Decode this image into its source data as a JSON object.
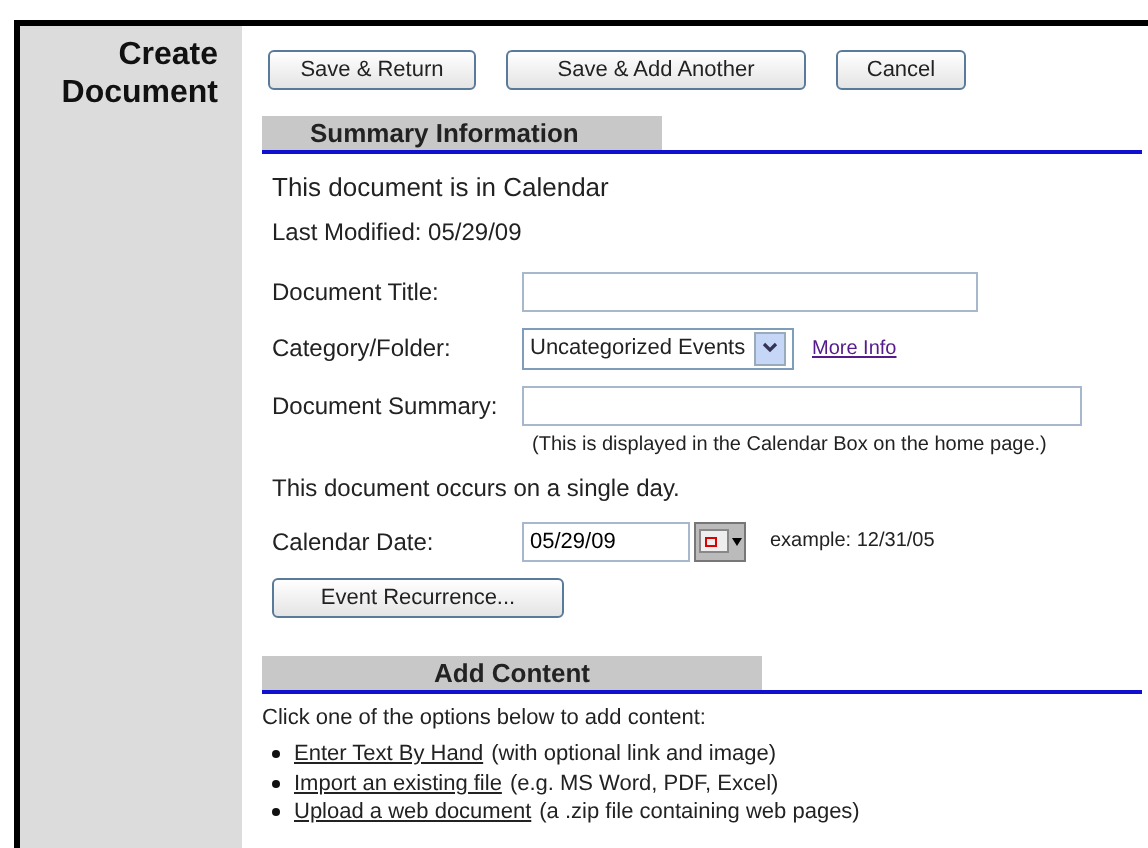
{
  "sidebar": {
    "title": "Create Document"
  },
  "buttons": [
    "Save & Return",
    "Save & Add Another",
    "Cancel"
  ],
  "summary": {
    "heading": "Summary Information",
    "location": "This document is in Calendar",
    "modified": "Last Modified: 05/29/09",
    "fields": [
      {
        "kind": "text",
        "label": "Document Title:"
      },
      {
        "kind": "select",
        "label": "Category/Folder:",
        "value": "Uncategorized Events",
        "link": "More Info"
      },
      {
        "kind": "wide",
        "label": "Document Summary:",
        "hint": "(This is displayed in the Calendar Box on the home page.)"
      }
    ],
    "occurs": "This document occurs on a single day.",
    "date": {
      "label": "Calendar Date:",
      "value": "05/29/09",
      "example": "example: 12/31/05"
    },
    "recurrence": "Event Recurrence..."
  },
  "content": {
    "heading": "Add Content",
    "intro": "Click one of the options below to add content:",
    "options": [
      {
        "link": "Enter Text By Hand",
        "note": "(with optional link and image)"
      },
      {
        "link": "Import an existing file",
        "note": "(e.g. MS Word, PDF, Excel)"
      },
      {
        "link": "Upload a web document",
        "note": "(a .zip file containing web pages)"
      }
    ]
  }
}
